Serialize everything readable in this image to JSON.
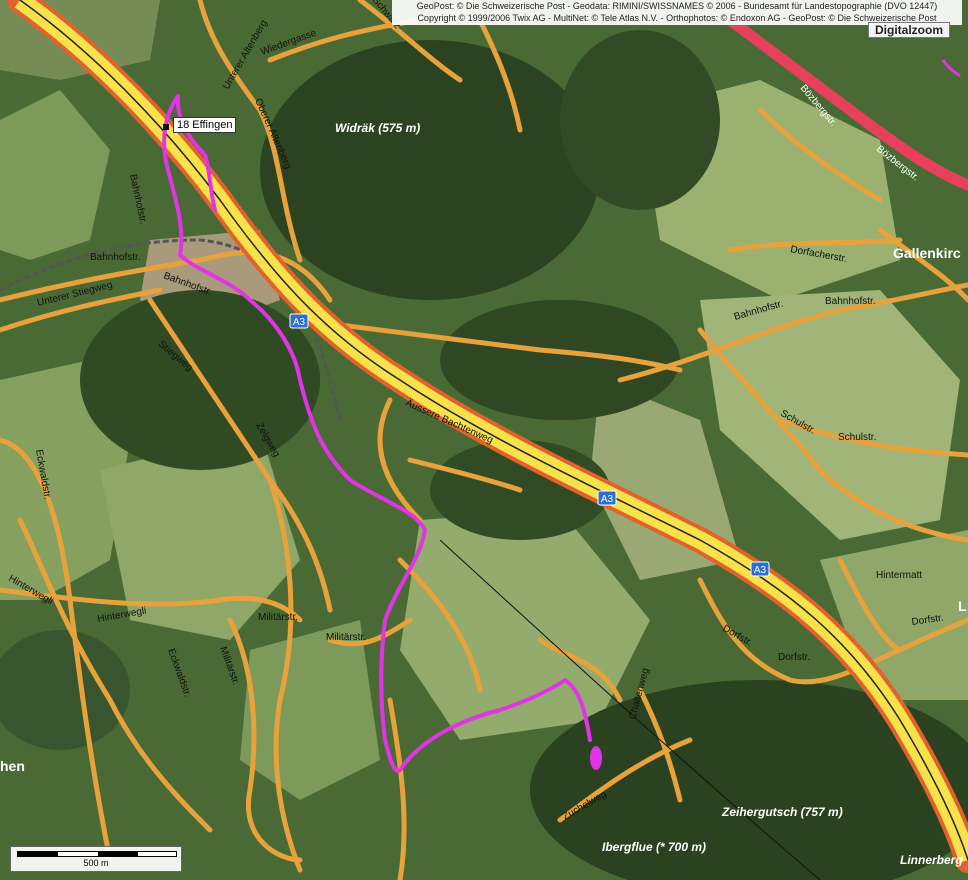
{
  "copyright": {
    "line1": "GeoPost: © Die Schweizerische Post - Geodata: RIMINI/SWISSNAMES © 2006 - Bundesamt für Landestopographie (DVO 12447)",
    "line2": "Copyright © 1999/2006 Twix AG - MultiNet: © Tele Atlas N.V. - Orthophotos: © Endoxon AG - GeoPost: © Die Schweizerische Post"
  },
  "toolbar": {
    "zoom_label": "Digitalzoom"
  },
  "scale": {
    "label": "500 m"
  },
  "route": {
    "stop_label": "18 Effingen",
    "color": "#e234e6"
  },
  "places": {
    "widrak": "Widräk (575 m)",
    "gallenkirch": "Gallenkirc",
    "zeihergutsch": "Zeihergutsch (757 m)",
    "ibergflue": "Ibergflue (* 700 m)",
    "linnerberg": "Linnerberg",
    "hen": "hen",
    "l": "L"
  },
  "roads": {
    "a3": "A3",
    "bahnhofstr": "Bahnhofstr.",
    "unterer_stiegweg": "Unterer Stiegweg",
    "stiegweg": "Stiegweg",
    "dorfacherstr": "Dorfacherstr.",
    "schulstr": "Schulstr.",
    "dorfstr": "Dorfstr.",
    "hintermatt": "Hintermatt",
    "militarstr": "Militärstr.",
    "hinterwegli": "Hinterwegli",
    "bozbergstr": "Bözbergstr.",
    "aussere_bachtenweg": "Äussere Bachtenweg",
    "zelgweg": "Zelgweg",
    "unterer_altenberg": "Unterer Altenberg",
    "oberer_altenberg": "Oberer Altenberg",
    "wiedergasse": "Wiedergasse",
    "schwarz": "Schwarz",
    "eckwaldstr": "Eckwaldstr.",
    "zuchelweg": "Zuchelweg",
    "chaltenweg": "Chaltenweg"
  }
}
